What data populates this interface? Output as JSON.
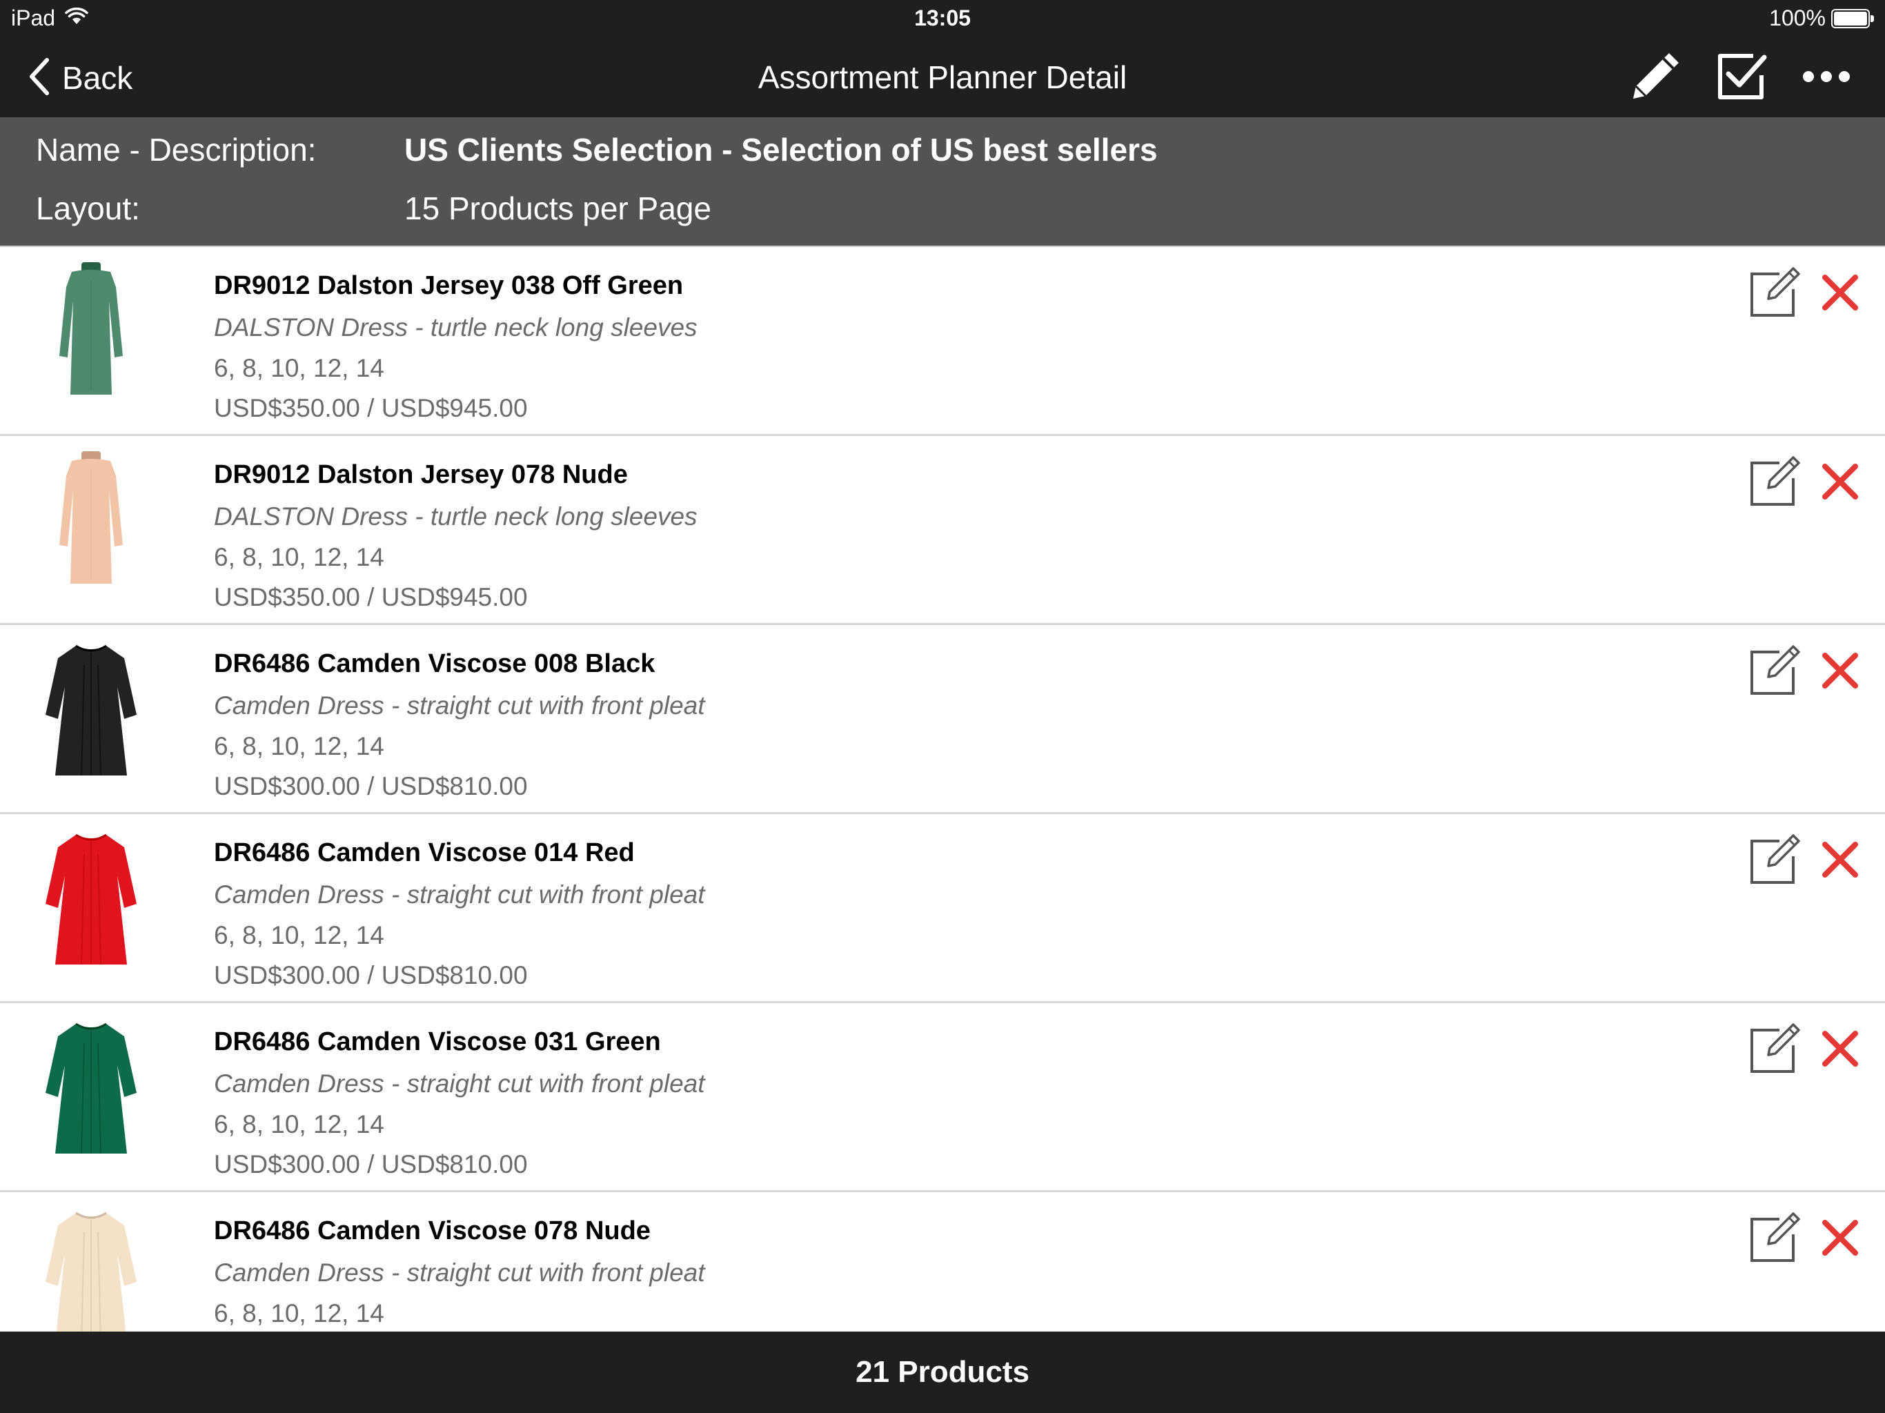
{
  "status_bar": {
    "device": "iPad",
    "time": "13:05",
    "battery": "100%",
    "wifi_icon": "wifi-icon",
    "battery_icon": "battery-icon"
  },
  "nav": {
    "back_label": "Back",
    "title": "Assortment Planner Detail",
    "icons": [
      "pencil-icon",
      "checkbox-icon",
      "more-icon"
    ]
  },
  "info": {
    "name_label": "Name - Description:",
    "name_value": "US Clients Selection - Selection of US best sellers",
    "layout_label": "Layout:",
    "layout_value": "15 Products per Page"
  },
  "products": [
    {
      "title": "DR9012 Dalston Jersey 038 Off Green",
      "description": "DALSTON Dress - turtle neck long sleeves",
      "sizes": "6, 8, 10, 12, 14",
      "price": "USD$350.00 / USD$945.00",
      "color": "#4f8a6f"
    },
    {
      "title": "DR9012 Dalston Jersey 078 Nude",
      "description": "DALSTON Dress - turtle neck long sleeves",
      "sizes": "6, 8, 10, 12, 14",
      "price": "USD$350.00 / USD$945.00",
      "color": "#f1c4a6"
    },
    {
      "title": "DR6486 Camden Viscose 008 Black",
      "description": "Camden Dress - straight cut with front pleat",
      "sizes": "6, 8, 10, 12, 14",
      "price": "USD$300.00 / USD$810.00",
      "color": "#222222"
    },
    {
      "title": "DR6486 Camden Viscose 014 Red",
      "description": "Camden Dress - straight cut with front pleat",
      "sizes": "6, 8, 10, 12, 14",
      "price": "USD$300.00 / USD$810.00",
      "color": "#e0141f"
    },
    {
      "title": "DR6486 Camden Viscose 031 Green",
      "description": "Camden Dress - straight cut with front pleat",
      "sizes": "6, 8, 10, 12, 14",
      "price": "USD$300.00 / USD$810.00",
      "color": "#0e6b4a"
    },
    {
      "title": "DR6486 Camden Viscose 078 Nude",
      "description": "Camden Dress - straight cut with front pleat",
      "sizes": "6, 8, 10, 12, 14",
      "price": "",
      "color": "#f3e2c8"
    }
  ],
  "row_icons": {
    "edit": "edit-icon",
    "delete": "delete-icon"
  },
  "colors": {
    "bar": "#1f1f1f",
    "info_panel": "#535353",
    "delete": "#e53935"
  },
  "footer": {
    "count": "21 Products"
  }
}
